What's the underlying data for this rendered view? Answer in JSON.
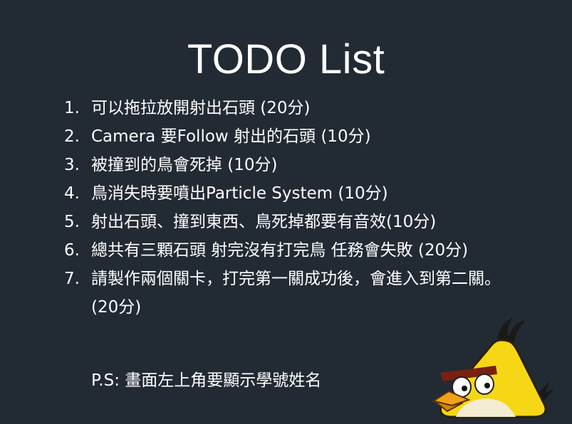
{
  "slide": {
    "title": "TODO List",
    "items": [
      {
        "num": "1.",
        "text": "可以拖拉放開射出石頭 (20分)"
      },
      {
        "num": "2.",
        "text": "Camera 要Follow 射出的石頭 (10分)"
      },
      {
        "num": "3.",
        "text": "被撞到的鳥會死掉 (10分)"
      },
      {
        "num": "4.",
        "text": "鳥消失時要噴出Particle System (10分)"
      },
      {
        "num": "5.",
        "text": "射出石頭、撞到東西、鳥死掉都要有音效(10分)"
      },
      {
        "num": "6.",
        "text": "總共有三顆石頭 射完沒有打完鳥 任務會失敗 (20分)"
      },
      {
        "num": "7.",
        "text": "請製作兩個關卡，打完第一關成功後，會進入到第二關。(20分)"
      }
    ],
    "ps": "P.S: 畫面左上角要顯示學號姓名",
    "image": "yellow-angry-bird-icon"
  },
  "colors": {
    "background": "#222a33",
    "text": "#ffffff",
    "bird_yellow": "#f5d716",
    "bird_beak": "#f0a21a"
  }
}
